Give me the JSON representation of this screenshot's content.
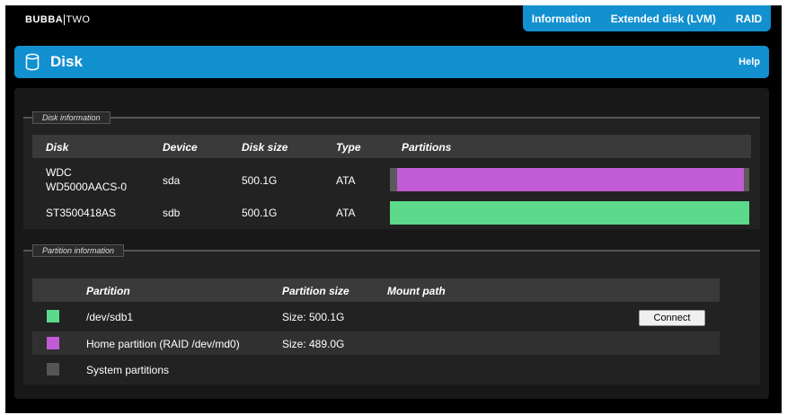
{
  "brand": {
    "left": "BUBBA",
    "right": "TWO"
  },
  "topnav": {
    "items": [
      "Information",
      "Extended disk (LVM)",
      "RAID"
    ]
  },
  "header": {
    "title": "Disk",
    "help": "Help",
    "icon": "database-icon"
  },
  "disk_section": {
    "legend": "Disk information",
    "columns": [
      "Disk",
      "Device",
      "Disk size",
      "Type",
      "Partitions"
    ],
    "rows": [
      {
        "disk_line1": "WDC",
        "disk_line2": "WD5000AACS-0",
        "device": "sda",
        "size": "500.1G",
        "type": "ATA",
        "partitions": [
          {
            "color": "#5a5a5a",
            "fraction": 0.02
          },
          {
            "color": "#c25bd6",
            "fraction": 0.965
          },
          {
            "color": "#5a5a5a",
            "fraction": 0.015
          }
        ]
      },
      {
        "disk_line1": "ST3500418AS",
        "disk_line2": "",
        "device": "sdb",
        "size": "500.1G",
        "type": "ATA",
        "partitions": [
          {
            "color": "#5cd98a",
            "fraction": 1.0
          }
        ]
      }
    ]
  },
  "partition_section": {
    "legend": "Partition information",
    "columns": [
      "Partition",
      "Partition size",
      "Mount path"
    ],
    "rows": [
      {
        "color": "#5cd98a",
        "name": "/dev/sdb1",
        "size": "Size: 500.1G",
        "mount": "",
        "action": "Connect"
      },
      {
        "color": "#c25bd6",
        "name": "Home partition (RAID /dev/md0)",
        "size": "Size: 489.0G",
        "mount": "",
        "action": ""
      },
      {
        "color": "#555555",
        "name": "System partitions",
        "size": "",
        "mount": "",
        "action": ""
      }
    ]
  }
}
